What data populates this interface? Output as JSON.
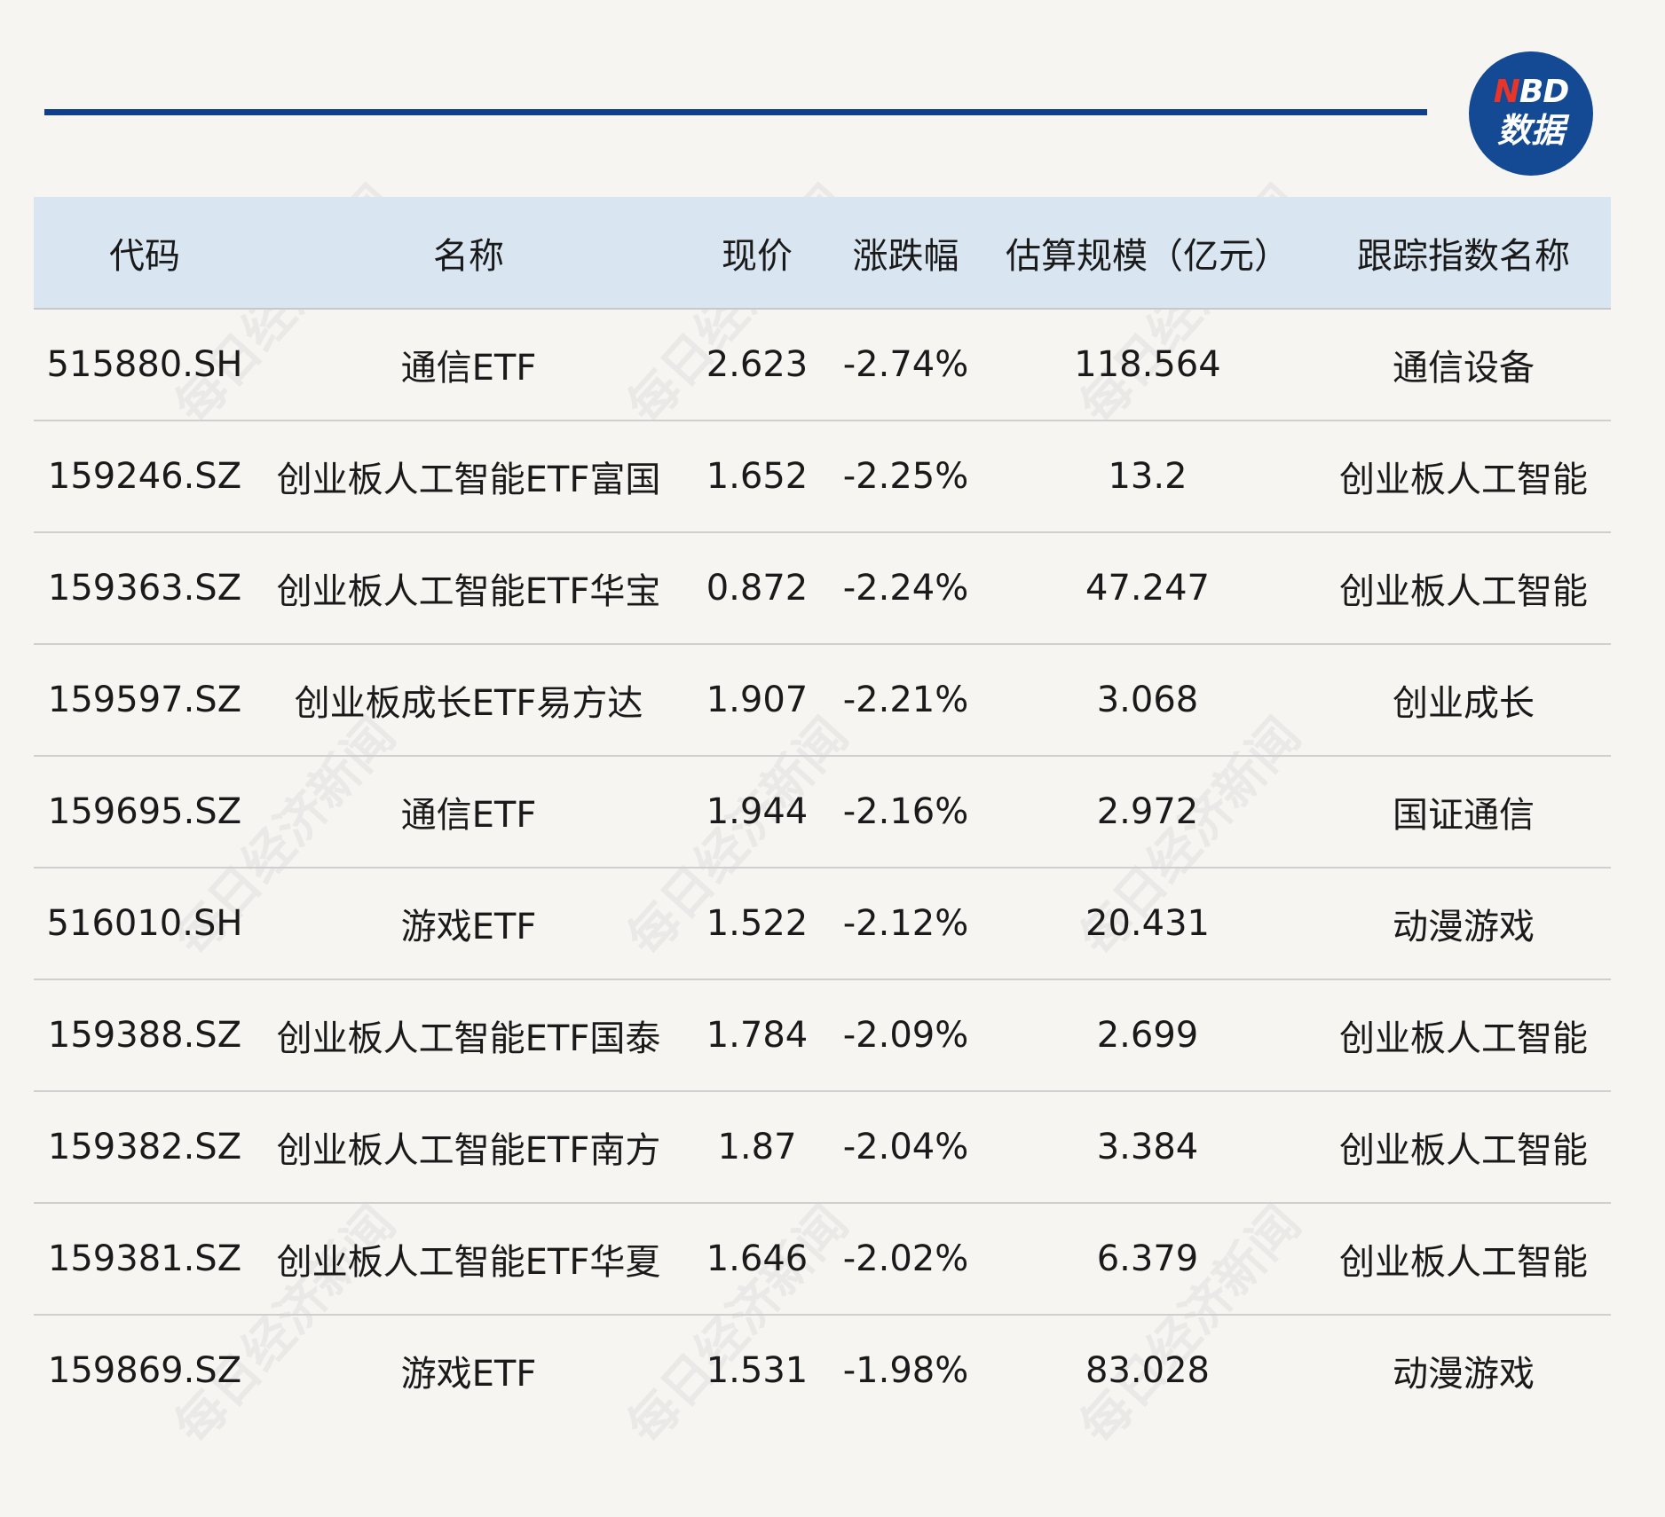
{
  "logo": {
    "n": "N",
    "bd": "BD",
    "line2": "数据"
  },
  "watermark": "每日经济新闻",
  "table": {
    "headers": [
      "代码",
      "名称",
      "现价",
      "涨跌幅",
      "估算规模（亿元）",
      "跟踪指数名称"
    ],
    "rows": [
      [
        "515880.SH",
        "通信ETF",
        "2.623",
        "-2.74%",
        "118.564",
        "通信设备"
      ],
      [
        "159246.SZ",
        "创业板人工智能ETF富国",
        "1.652",
        "-2.25%",
        "13.2",
        "创业板人工智能"
      ],
      [
        "159363.SZ",
        "创业板人工智能ETF华宝",
        "0.872",
        "-2.24%",
        "47.247",
        "创业板人工智能"
      ],
      [
        "159597.SZ",
        "创业板成长ETF易方达",
        "1.907",
        "-2.21%",
        "3.068",
        "创业成长"
      ],
      [
        "159695.SZ",
        "通信ETF",
        "1.944",
        "-2.16%",
        "2.972",
        "国证通信"
      ],
      [
        "516010.SH",
        "游戏ETF",
        "1.522",
        "-2.12%",
        "20.431",
        "动漫游戏"
      ],
      [
        "159388.SZ",
        "创业板人工智能ETF国泰",
        "1.784",
        "-2.09%",
        "2.699",
        "创业板人工智能"
      ],
      [
        "159382.SZ",
        "创业板人工智能ETF南方",
        "1.87",
        "-2.04%",
        "3.384",
        "创业板人工智能"
      ],
      [
        "159381.SZ",
        "创业板人工智能ETF华夏",
        "1.646",
        "-2.02%",
        "6.379",
        "创业板人工智能"
      ],
      [
        "159869.SZ",
        "游戏ETF",
        "1.531",
        "-1.98%",
        "83.028",
        "动漫游戏"
      ]
    ]
  },
  "colors": {
    "accent": "#0d3f8c",
    "header_bg": "#d9e6f1",
    "background": "#f7f5f2",
    "logo_bg": "#134a93",
    "logo_n": "#e8352a"
  }
}
